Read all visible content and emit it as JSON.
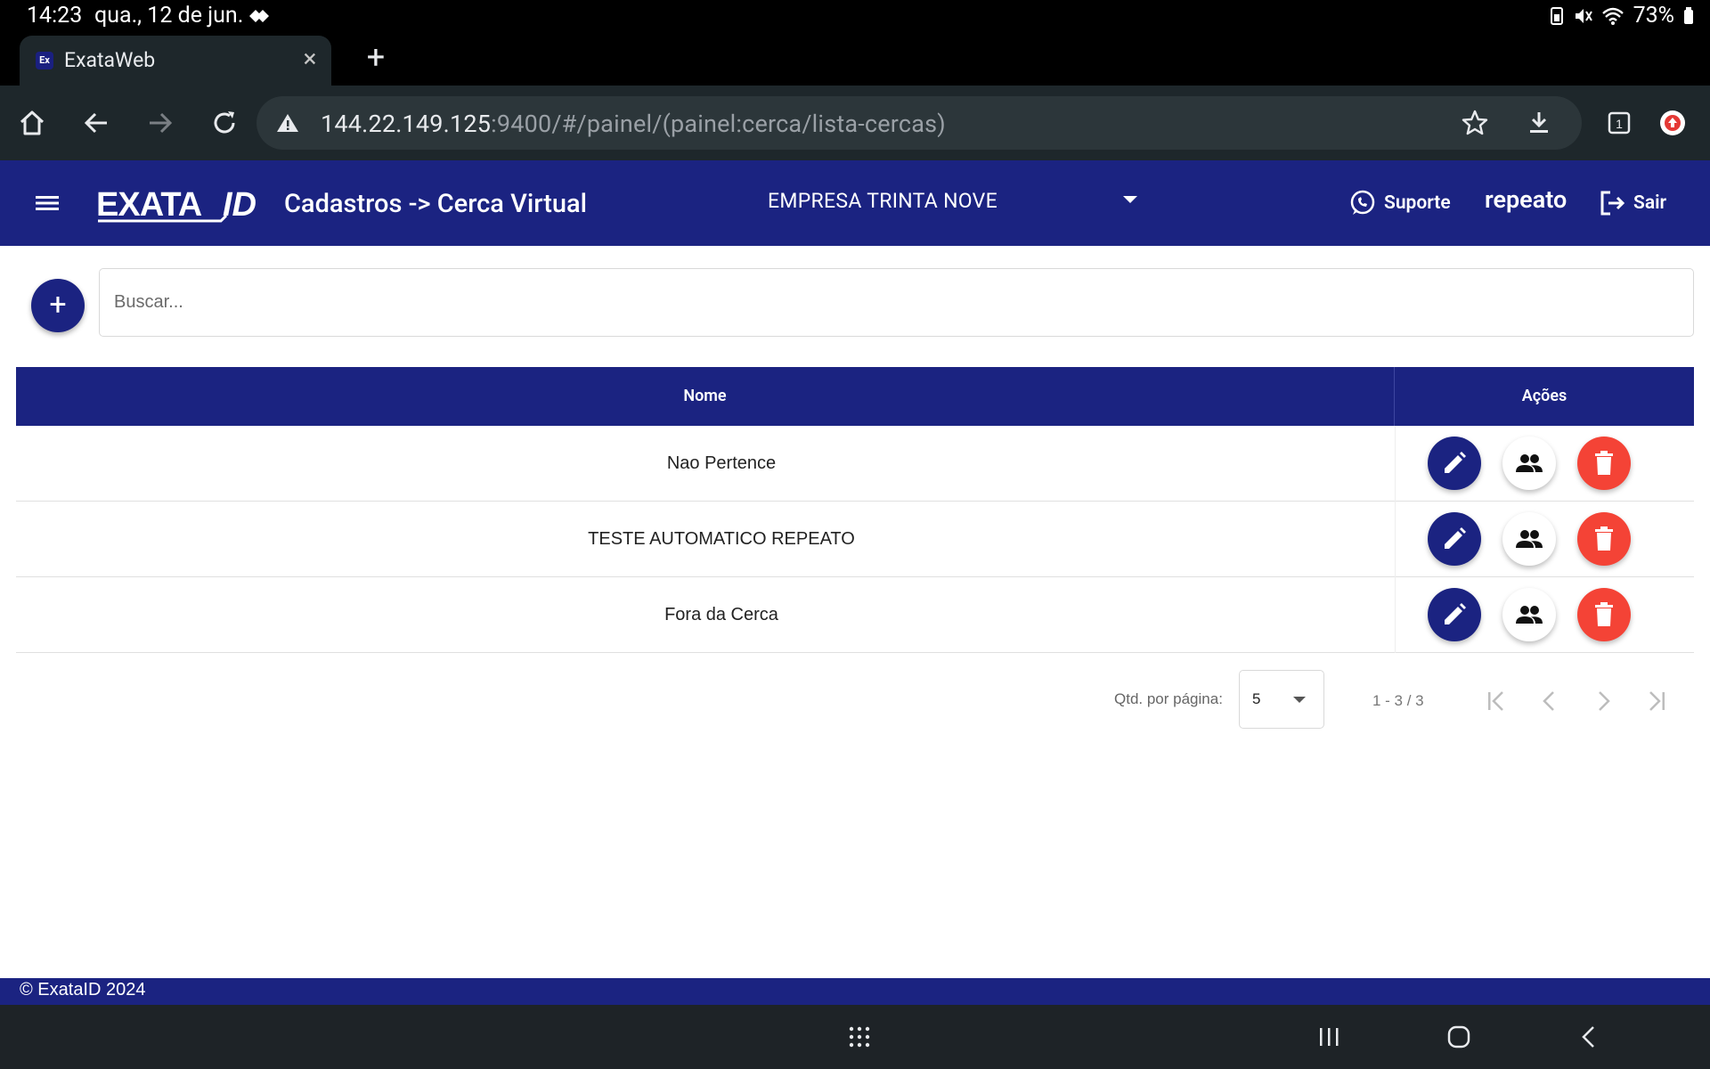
{
  "status_bar": {
    "time": "14:23",
    "date": "qua., 12 de jun.",
    "battery": "73%"
  },
  "browser": {
    "tab_title": "ExataWeb",
    "favicon_text": "Ex",
    "url_host": "144.22.149.125",
    "url_rest": ":9400/#/painel/(painel:cerca/lista-cercas)",
    "tab_count": "1"
  },
  "appbar": {
    "logo": "EXATA ID",
    "title": "Cadastros -> Cerca Virtual",
    "company": "EMPRESA TRINTA NOVE",
    "support": "Suporte",
    "username": "repeato",
    "logout": "Sair"
  },
  "search": {
    "placeholder": "Buscar..."
  },
  "table": {
    "headers": [
      "Nome",
      "Ações"
    ],
    "rows": [
      {
        "name": "Nao Pertence"
      },
      {
        "name": "TESTE AUTOMATICO REPEATO"
      },
      {
        "name": "Fora da Cerca"
      }
    ]
  },
  "paginator": {
    "label": "Qtd. por página:",
    "page_size": "5",
    "range": "1 - 3 / 3"
  },
  "footer": {
    "copyright": "© ExataID 2024"
  },
  "colors": {
    "primary": "#1b2381",
    "danger": "#f44336"
  }
}
